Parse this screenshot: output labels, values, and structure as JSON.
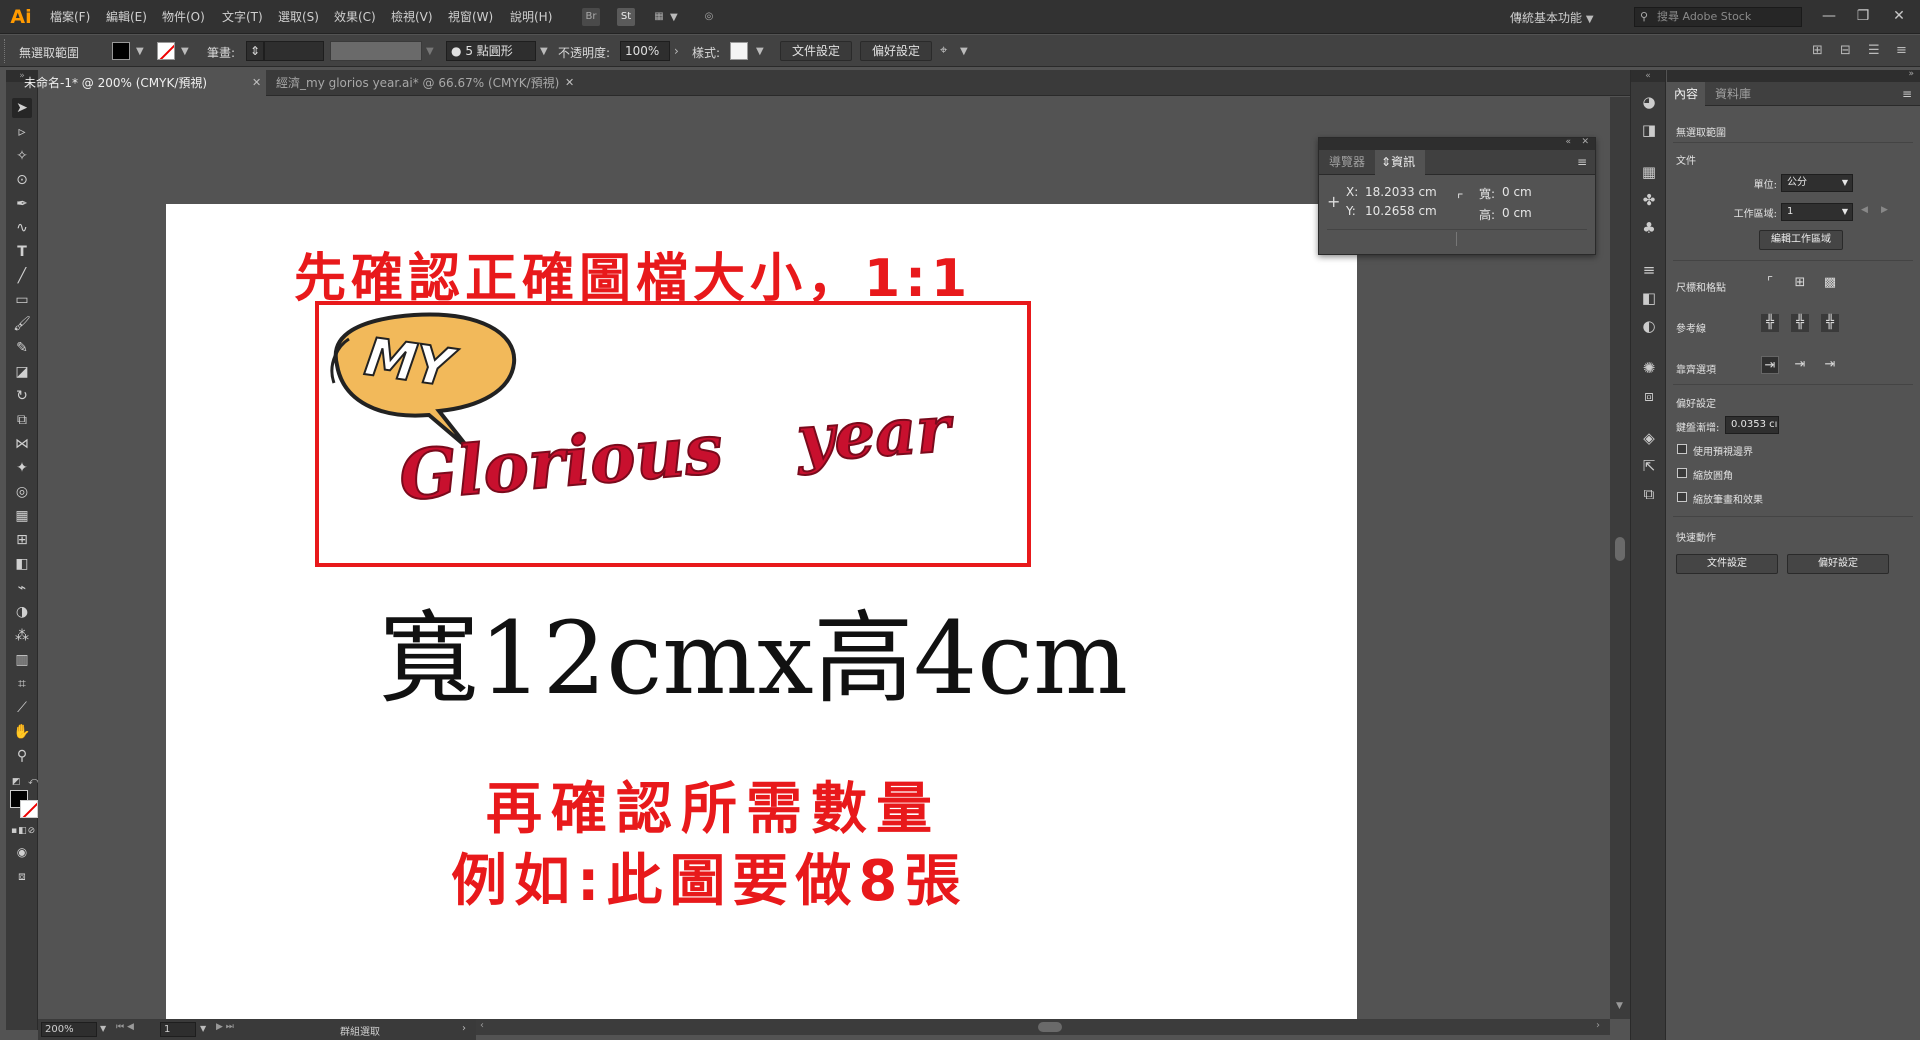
{
  "menubar": {
    "logo": "Ai",
    "items": [
      "檔案(F)",
      "編輯(E)",
      "物件(O)",
      "文字(T)",
      "選取(S)",
      "效果(C)",
      "檢視(V)",
      "視窗(W)",
      "說明(H)"
    ],
    "bridge_label": "Br",
    "stock_label": "St",
    "workspace": "傳統基本功能",
    "search_placeholder": "搜尋 Adobe Stock",
    "minimize": "—",
    "restore": "❐",
    "close": "✕"
  },
  "control_bar": {
    "selection_status": "無選取範圍",
    "stroke_label": "筆畫:",
    "brush_label": "5 點圓形",
    "opacity_label": "不透明度:",
    "opacity_value": "100%",
    "style_label": "樣式:",
    "document_setup": "文件設定",
    "preferences": "偏好設定"
  },
  "tabs": [
    {
      "label": "未命名-1* @ 200% (CMYK/預視)",
      "active": true
    },
    {
      "label": "經濟_my glorios year.ai* @ 66.67% (CMYK/預視)",
      "active": false
    }
  ],
  "info_panel": {
    "tab_navigator": "導覽器",
    "tab_info": "資訊",
    "x_label": "X:",
    "x_value": "18.2033 cm",
    "y_label": "Y:",
    "y_value": "10.2658 cm",
    "w_label": "寬:",
    "w_value": "0 cm",
    "h_label": "高:",
    "h_value": "0 cm"
  },
  "artwork": {
    "title_line": "先確認正確圖檔大小，1:1",
    "logo_my": "MY",
    "logo_glorious": "Glorious",
    "logo_year": "year",
    "dimension_text": "寬12cmx高4cm",
    "quantity_line1": "再確認所需數量",
    "quantity_line2": "例如:此圖要做8張"
  },
  "status_bar": {
    "zoom": "200%",
    "artboard_number": "1",
    "status_text": "群組選取"
  },
  "properties": {
    "tab_properties": "內容",
    "tab_libraries": "資料庫",
    "no_selection": "無選取範圍",
    "document_section": "文件",
    "units_label": "單位:",
    "units_value": "公分",
    "artboard_label": "工作區域:",
    "artboard_value": "1",
    "edit_artboards": "編輯工作區域",
    "rulers_grids": "尺標和格點",
    "guides": "參考線",
    "snap_options": "靠齊選項",
    "preferences_section": "偏好設定",
    "keyboard_increment_label": "鍵盤漸增:",
    "keyboard_increment_value": "0.0353 cı",
    "use_preview_bounds": "使用預視邊界",
    "scale_corners": "縮放圓角",
    "scale_strokes_effects": "縮放筆畫和效果",
    "quick_actions": "快速動作",
    "qa_document_setup": "文件設定",
    "qa_preferences": "偏好設定"
  },
  "colors": {
    "accent_red": "#e8191b",
    "logo_crimson": "#c8102e",
    "bubble_orange": "#f2b95a",
    "ai_orange": "#ff9a00"
  }
}
